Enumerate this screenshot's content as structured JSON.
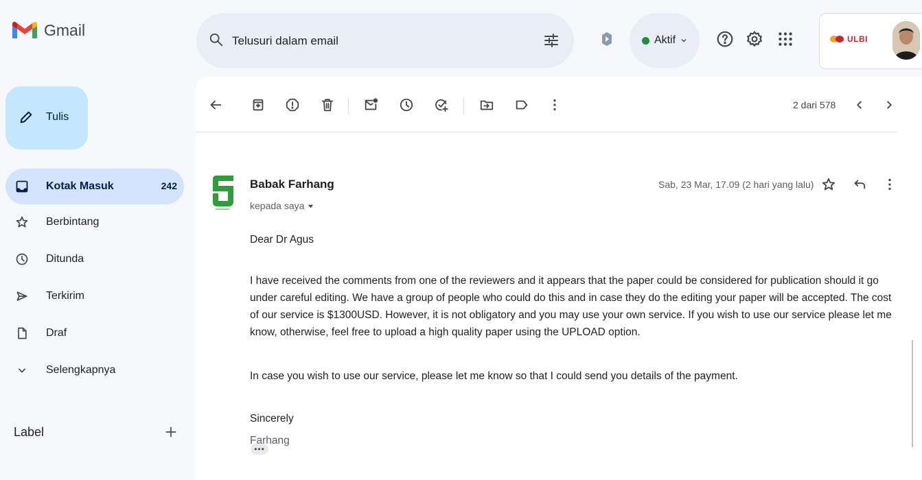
{
  "header": {
    "app_name": "Gmail",
    "search_placeholder": "Telusuri dalam email",
    "status_label": "Aktif",
    "org_name": "ULBI"
  },
  "sidebar": {
    "compose_label": "Tulis",
    "items": [
      {
        "label": "Kotak Masuk",
        "count": "242",
        "icon": "inbox-icon"
      },
      {
        "label": "Berbintang",
        "count": "",
        "icon": "star-icon"
      },
      {
        "label": "Ditunda",
        "count": "",
        "icon": "clock-icon"
      },
      {
        "label": "Terkirim",
        "count": "",
        "icon": "send-icon"
      },
      {
        "label": "Draf",
        "count": "",
        "icon": "draft-icon"
      },
      {
        "label": "Selengkapnya",
        "count": "",
        "icon": "chevron-down-icon"
      }
    ],
    "labels_title": "Label"
  },
  "toolbar": {
    "pager": "2 dari 578"
  },
  "message": {
    "sender_name": "Babak Farhang",
    "to_label": "kepada saya",
    "date": "Sab, 23 Mar, 17.09 (2 hari yang lalu)",
    "greeting": "Dear Dr Agus",
    "paragraph": "I have received the comments from one of the reviewers and it appears that the paper could be considered for publication should it go under careful editing. We have a group of people who could do this and in case they do the editing your paper will be accepted. The cost of our service is $1300USD. However, it is not obligatory and you may use your own service. If you wish to use our service please let me know, otherwise, feel free to upload a high quality paper using the UPLOAD option.",
    "paragraph2": "In case you wish to use our service, please let me know so that I could send you details of the payment.",
    "closing": "Sincerely",
    "signature": "Farhang",
    "more_label": "•••"
  },
  "colors": {
    "compose_bg": "#c2e7ff",
    "active_nav_bg": "#d3e3fd",
    "status_dot": "#1e8e3e",
    "sender_logo": "#2e9d3a"
  }
}
